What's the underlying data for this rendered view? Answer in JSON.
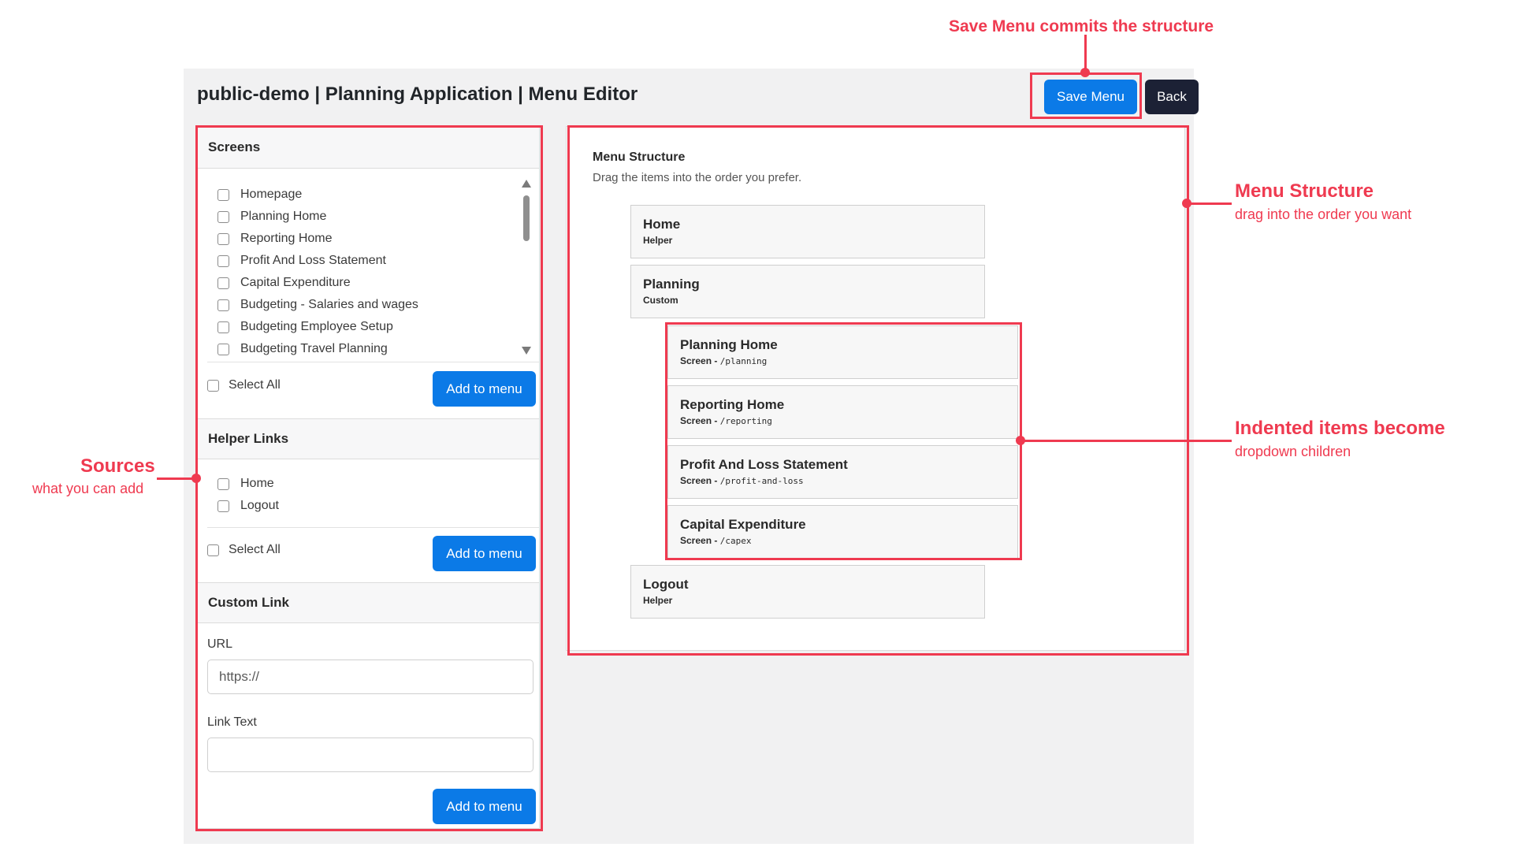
{
  "header": {
    "title": "public-demo | Planning Application | Menu Editor",
    "save_label": "Save Menu",
    "back_label": "Back"
  },
  "sources": {
    "screens": {
      "heading": "Screens",
      "items": [
        "Homepage",
        "Planning Home",
        "Reporting Home",
        "Profit And Loss Statement",
        "Capital Expenditure",
        "Budgeting - Salaries and wages",
        "Budgeting Employee Setup",
        "Budgeting Travel Planning"
      ],
      "select_all": "Select All",
      "add_label": "Add to menu"
    },
    "helper_links": {
      "heading": "Helper Links",
      "items": [
        "Home",
        "Logout"
      ],
      "select_all": "Select All",
      "add_label": "Add to menu"
    },
    "custom_link": {
      "heading": "Custom Link",
      "url_label": "URL",
      "url_placeholder": "https://",
      "link_text_label": "Link Text",
      "link_text_value": "",
      "add_label": "Add to menu"
    }
  },
  "structure": {
    "title": "Menu Structure",
    "subtitle": "Drag the items into the order you prefer.",
    "items": [
      {
        "title": "Home",
        "type": "Helper",
        "path": ""
      },
      {
        "title": "Planning",
        "type": "Custom",
        "path": ""
      },
      {
        "title": "Planning Home",
        "type": "Screen",
        "path": "/planning"
      },
      {
        "title": "Reporting Home",
        "type": "Screen",
        "path": "/reporting"
      },
      {
        "title": "Profit And Loss Statement",
        "type": "Screen",
        "path": "/profit-and-loss"
      },
      {
        "title": "Capital Expenditure",
        "type": "Screen",
        "path": "/capex"
      },
      {
        "title": "Logout",
        "type": "Helper",
        "path": ""
      }
    ],
    "separator": " - "
  },
  "annotations": {
    "save": "Save Menu commits the structure",
    "sources_title": "Sources",
    "sources_sub": "what you can add",
    "structure_title": "Menu Structure",
    "structure_sub": "drag into the order you want",
    "indent_title": "Indented items become",
    "indent_sub": "dropdown children",
    "color": "#ef3a50"
  },
  "colors": {
    "primary": "#0b7ae7",
    "dark": "#1c2135",
    "app_background": "#f1f1f2"
  }
}
